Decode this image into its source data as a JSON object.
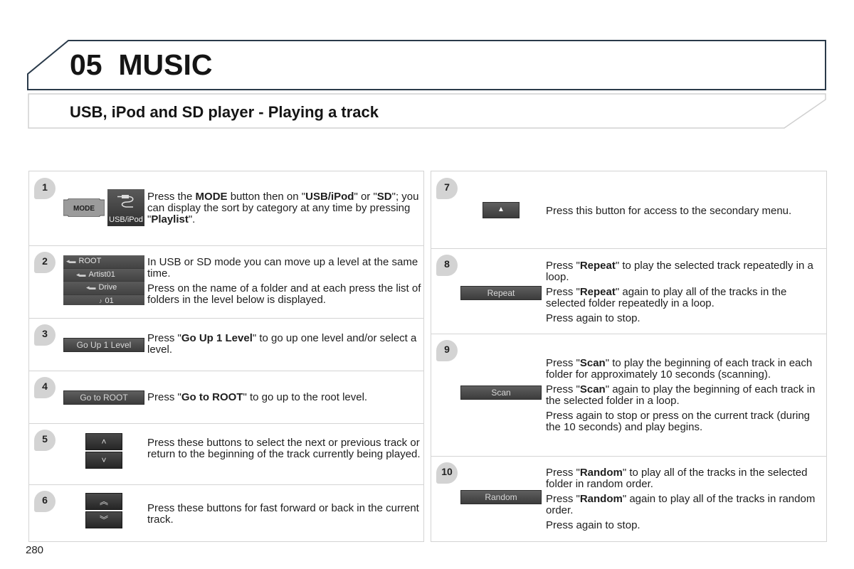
{
  "header": {
    "chapter_number": "05",
    "chapter_name": "MUSIC",
    "section_title": "USB, iPod and SD player - Playing a track",
    "accent_color": "#2a3a4a"
  },
  "page_number": "280",
  "steps": [
    {
      "number": "1",
      "buttons": {
        "mode": "MODE",
        "usb": "USB/iPod",
        "usb_icon": "usb-cable-icon"
      },
      "paragraphs": [
        {
          "parts": [
            {
              "t": "Press the "
            },
            {
              "b": "MODE"
            },
            {
              "t": " button then on \""
            },
            {
              "b": "USB/iPod"
            },
            {
              "t": "\" or \""
            },
            {
              "b": "SD"
            },
            {
              "t": "\"; you can display the sort by category at any time by pressing \""
            },
            {
              "b": "Playlist"
            },
            {
              "t": "\"."
            }
          ]
        }
      ]
    },
    {
      "number": "2",
      "tree": [
        {
          "icon": "folder-back-icon",
          "label": "ROOT"
        },
        {
          "icon": "folder-back-icon",
          "label": "Artist01"
        },
        {
          "icon": "folder-back-icon",
          "label": "Drive"
        },
        {
          "icon": "music-note-icon",
          "label": "01"
        }
      ],
      "paragraphs": [
        {
          "parts": [
            {
              "t": "In USB or SD mode you can move up a level at the same time."
            }
          ]
        },
        {
          "parts": [
            {
              "t": "Press on the name of a folder and at each press the list of folders in the level below is displayed."
            }
          ]
        }
      ]
    },
    {
      "number": "3",
      "button": "Go Up 1 Level",
      "paragraphs": [
        {
          "parts": [
            {
              "t": "Press \""
            },
            {
              "b": "Go Up 1 Level"
            },
            {
              "t": "\" to go up one level and/or select a level."
            }
          ]
        }
      ]
    },
    {
      "number": "4",
      "button": "Go to ROOT",
      "paragraphs": [
        {
          "parts": [
            {
              "t": "Press \""
            },
            {
              "b": "Go to ROOT"
            },
            {
              "t": "\" to go up to the root level."
            }
          ]
        }
      ]
    },
    {
      "number": "5",
      "icons": {
        "up": "˄",
        "down": "˅"
      },
      "paragraphs": [
        {
          "parts": [
            {
              "t": "Press these buttons to select the next or previous track or return to the beginning of the track currently being played."
            }
          ]
        }
      ]
    },
    {
      "number": "6",
      "icons": {
        "up": "︽",
        "down": "︾"
      },
      "paragraphs": [
        {
          "parts": [
            {
              "t": "Press these buttons for fast forward or back in the current track."
            }
          ]
        }
      ]
    },
    {
      "number": "7",
      "icons": {
        "up": "▲"
      },
      "paragraphs": [
        {
          "parts": [
            {
              "t": "Press this button for access to the secondary menu."
            }
          ]
        }
      ]
    },
    {
      "number": "8",
      "button": "Repeat",
      "paragraphs": [
        {
          "parts": [
            {
              "t": "Press \""
            },
            {
              "b": "Repeat"
            },
            {
              "t": "\" to play the selected track repeatedly in a loop."
            }
          ]
        },
        {
          "parts": [
            {
              "t": "Press \""
            },
            {
              "b": "Repeat"
            },
            {
              "t": "\" again to play all of the tracks in the selected folder repeatedly in a loop."
            }
          ]
        },
        {
          "parts": [
            {
              "t": "Press again to stop."
            }
          ]
        }
      ]
    },
    {
      "number": "9",
      "button": "Scan",
      "paragraphs": [
        {
          "parts": [
            {
              "t": "Press \""
            },
            {
              "b": "Scan"
            },
            {
              "t": "\" to play the beginning of each track in each folder for approximately 10 seconds (scanning)."
            }
          ]
        },
        {
          "parts": [
            {
              "t": "Press \""
            },
            {
              "b": "Scan"
            },
            {
              "t": "\" again to play the beginning of each track in the selected folder in a loop."
            }
          ]
        },
        {
          "parts": [
            {
              "t": "Press again to stop or press on the current track (during the 10 seconds) and play begins."
            }
          ]
        }
      ]
    },
    {
      "number": "10",
      "button": "Random",
      "paragraphs": [
        {
          "parts": [
            {
              "t": "Press \""
            },
            {
              "b": "Random"
            },
            {
              "t": "\" to play all of the tracks in the selected folder in random order."
            }
          ]
        },
        {
          "parts": [
            {
              "t": "Press \""
            },
            {
              "b": "Random"
            },
            {
              "t": "\" again to play all of the tracks in random order."
            }
          ]
        },
        {
          "parts": [
            {
              "t": "Press again to stop."
            }
          ]
        }
      ]
    }
  ]
}
